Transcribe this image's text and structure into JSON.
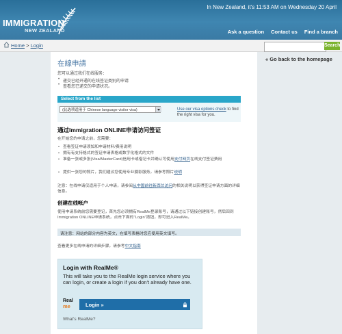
{
  "header": {
    "logo_line1": "IMMIGRATION",
    "logo_line2": "NEW ZEALAND",
    "datetime": "In New Zealand, it's 11:53 AM on Wednesday 20 April",
    "nav": [
      "Ask a question",
      "Contact us",
      "Find a branch"
    ]
  },
  "breadcrumb": {
    "home": "Home",
    "separator": ">",
    "current": "Login"
  },
  "search": {
    "placeholder": "",
    "button": "Search"
  },
  "sidebar": {
    "back_link": "« Go back to the homepage"
  },
  "content": {
    "title": "在線申請",
    "intro": "您可以通过我们在线服务：",
    "bullets": [
      "递交已经开通的在线签证类别的申请",
      "查看您已递交的申请状况。"
    ],
    "select_panel": {
      "header": "Select from the list",
      "selected": "(此选项适用于 Chinese language visitor visa)",
      "side_prefix": "",
      "side_link": "Use our visa options check",
      "side_suffix": " to find the right visa for you."
    },
    "section1_title": "通过Immigration ONLINE申请访问签证",
    "section1_intro": "在开始您的申请之前，您需要：",
    "req": [
      {
        "text": "查看签证申请须知和申请材料/费用说明"
      },
      {
        "text": "拥有有支持格式的签证申请表格或数字化格式的文件"
      },
      {
        "text": "准备一张或多张(Visa/MasterCard)信用卡或借记卡并确认可使用",
        "link": "支付网页",
        "text2": "在线支付签证费用"
      },
      {
        "text": "提供一张您的照片，我们建议您使用专业摄影服务，请参考照片",
        "link": "说明",
        "text2": ""
      }
    ],
    "note_prefix": "注意：在线申请仅适用于个人申请，请参阅",
    "note_link": "从中国前往新西兰访问",
    "note_suffix": "的相关说明以获得签证申请方面的详细信息。",
    "section2_title": "创建在线帐户",
    "section2_text": "使用申请系统前您需要登记，首先您必须拥有RealMe登录账号，请通过以下链接创建账号，然后回到Immigration ONLINE申请系统，点击下面的\"Login\"按钮，即可进入RealMe。",
    "notice": "请注意：网站的部分内容为英文，在填写表格时您应使用英文填写。",
    "more_prefix": "查看更多在线申请的详细步骤，请参考",
    "more_link": "中文指南",
    "realme": {
      "heading": "Login with RealMe®",
      "paragraph": "This will take you to the RealMe login service where you can login, or create a login if you don't already have one.",
      "logo_top": "Real",
      "logo_bottom": "me",
      "button": "Login »",
      "whats": "What's RealMe?"
    }
  }
}
